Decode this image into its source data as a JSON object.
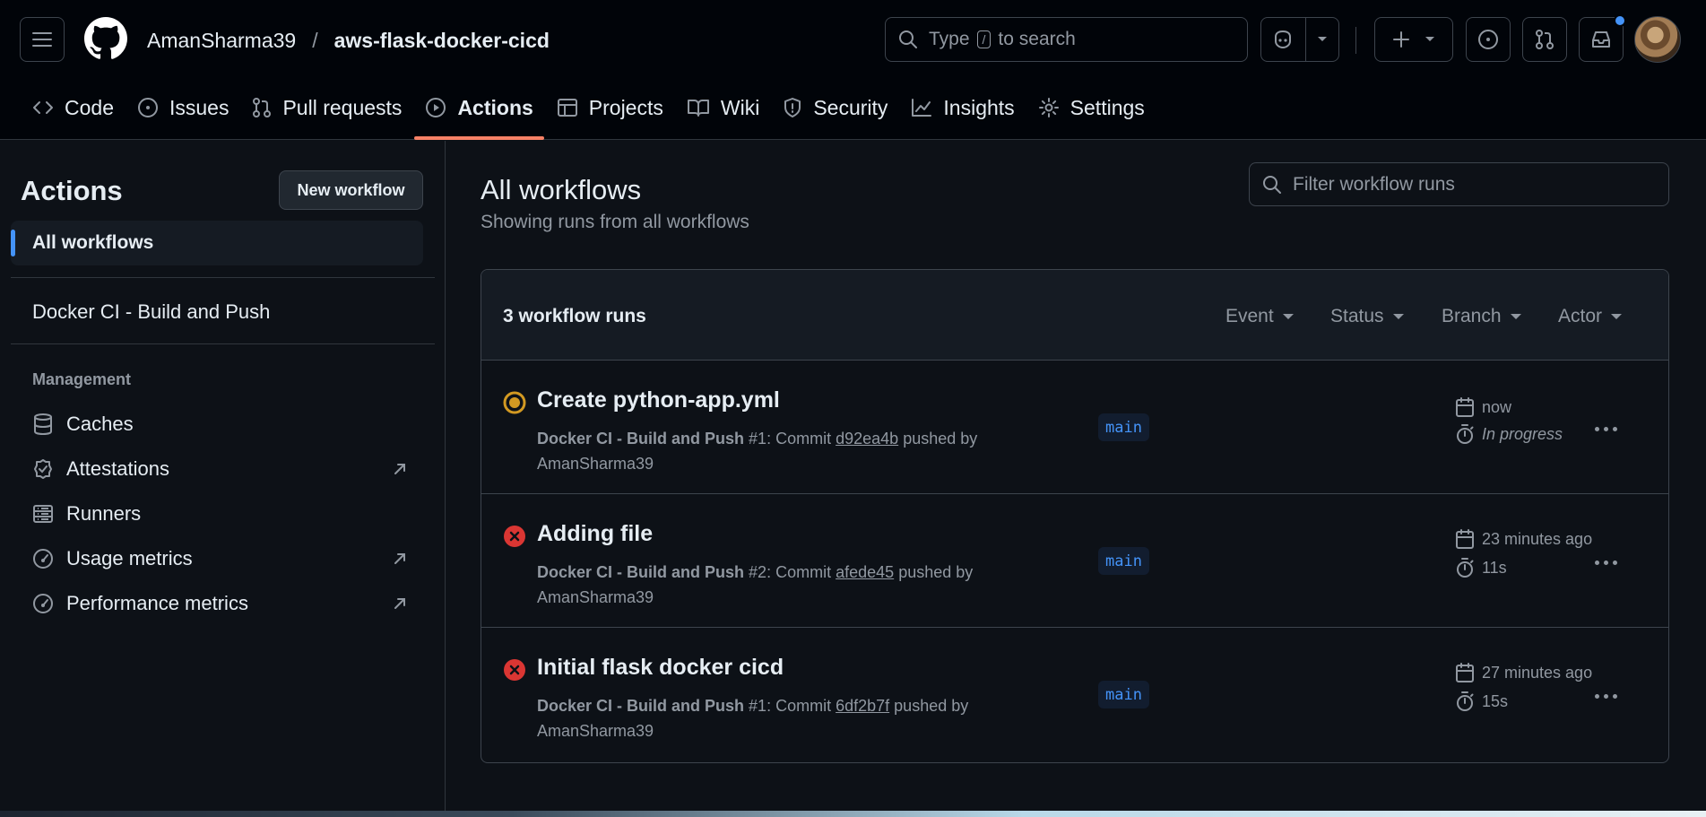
{
  "header": {
    "owner": "AmanSharma39",
    "separator": "/",
    "repo": "aws-flask-docker-cicd",
    "search_placeholder_prefix": "Type",
    "search_key": "/",
    "search_placeholder_suffix": "to search"
  },
  "tabs": [
    {
      "label": "Code",
      "icon": "code-icon"
    },
    {
      "label": "Issues",
      "icon": "issue-icon"
    },
    {
      "label": "Pull requests",
      "icon": "pull-request-icon"
    },
    {
      "label": "Actions",
      "icon": "play-icon",
      "active": true
    },
    {
      "label": "Projects",
      "icon": "table-icon"
    },
    {
      "label": "Wiki",
      "icon": "book-icon"
    },
    {
      "label": "Security",
      "icon": "shield-icon"
    },
    {
      "label": "Insights",
      "icon": "graph-icon"
    },
    {
      "label": "Settings",
      "icon": "gear-icon"
    }
  ],
  "sidebar": {
    "title": "Actions",
    "new_workflow": "New workflow",
    "all_workflows": "All workflows",
    "workflow": "Docker CI - Build and Push",
    "management_heading": "Management",
    "items": [
      {
        "label": "Caches",
        "icon": "database-icon",
        "external": false
      },
      {
        "label": "Attestations",
        "icon": "verified-icon",
        "external": true
      },
      {
        "label": "Runners",
        "icon": "server-icon",
        "external": false
      },
      {
        "label": "Usage metrics",
        "icon": "meter-icon",
        "external": true
      },
      {
        "label": "Performance metrics",
        "icon": "meter-icon",
        "external": true
      }
    ]
  },
  "main": {
    "title": "All workflows",
    "subtitle": "Showing runs from all workflows",
    "filter_placeholder": "Filter workflow runs",
    "runs_count": "3 workflow runs",
    "filters": [
      "Event",
      "Status",
      "Branch",
      "Actor"
    ],
    "runs": [
      {
        "status": "in-progress",
        "title": "Create python-app.yml",
        "workflow": "Docker CI - Build and Push",
        "run_text": "#1: Commit",
        "sha": "d92ea4b",
        "pushed_by": "pushed by",
        "author": "AmanSharma39",
        "branch": "main",
        "when": "now",
        "duration": "In progress"
      },
      {
        "status": "failure",
        "title": "Adding file",
        "workflow": "Docker CI - Build and Push",
        "run_text": "#2: Commit",
        "sha": "afede45",
        "pushed_by": "pushed by",
        "author": "AmanSharma39",
        "branch": "main",
        "when": "23 minutes ago",
        "duration": "11s"
      },
      {
        "status": "failure",
        "title": "Initial flask docker cicd",
        "workflow": "Docker CI - Build and Push",
        "run_text": "#1: Commit",
        "sha": "6df2b7f",
        "pushed_by": "pushed by",
        "author": "AmanSharma39",
        "branch": "main",
        "when": "27 minutes ago",
        "duration": "15s"
      }
    ]
  },
  "colors": {
    "accent": "#f78166",
    "link": "#4493f8",
    "failure": "#da3633",
    "in_progress": "#d29922"
  }
}
